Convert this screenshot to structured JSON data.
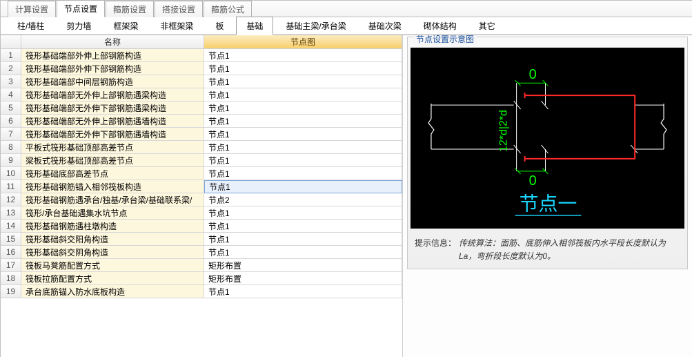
{
  "topTabs": {
    "items": [
      {
        "label": "计算设置"
      },
      {
        "label": "节点设置",
        "active": true
      },
      {
        "label": "箍筋设置"
      },
      {
        "label": "搭接设置"
      },
      {
        "label": "箍筋公式"
      }
    ]
  },
  "subTabs": {
    "items": [
      {
        "label": "柱/墙柱"
      },
      {
        "label": "剪力墙"
      },
      {
        "label": "框架梁"
      },
      {
        "label": "非框架梁"
      },
      {
        "label": "板"
      },
      {
        "label": "基础",
        "active": true
      },
      {
        "label": "基础主梁/承台梁"
      },
      {
        "label": "基础次梁"
      },
      {
        "label": "砌体结构"
      },
      {
        "label": "其它"
      }
    ]
  },
  "table": {
    "headers": {
      "name": "名称",
      "val": "节点图"
    },
    "rows": [
      {
        "n": "1",
        "name": "筏形基础端部外伸上部钢筋构造",
        "val": "节点1"
      },
      {
        "n": "2",
        "name": "筏形基础端部外伸下部钢筋构造",
        "val": "节点1"
      },
      {
        "n": "3",
        "name": "筏形基础端部中间层钢筋构造",
        "val": "节点1"
      },
      {
        "n": "4",
        "name": "筏形基础端部无外伸上部钢筋遇梁构造",
        "val": "节点1"
      },
      {
        "n": "5",
        "name": "筏形基础端部无外伸下部钢筋遇梁构造",
        "val": "节点1"
      },
      {
        "n": "6",
        "name": "筏形基础端部无外伸上部钢筋遇墙构造",
        "val": "节点1"
      },
      {
        "n": "7",
        "name": "筏形基础端部无外伸下部钢筋遇墙构造",
        "val": "节点1"
      },
      {
        "n": "8",
        "name": "平板式筏形基础顶部高差节点",
        "val": "节点1"
      },
      {
        "n": "9",
        "name": "梁板式筏形基础顶部高差节点",
        "val": "节点1"
      },
      {
        "n": "10",
        "name": "筏形基础底部高差节点",
        "val": "节点1"
      },
      {
        "n": "11",
        "name": "筏形基础钢筋锚入相邻筏板构造",
        "val": "节点1",
        "selected": true
      },
      {
        "n": "12",
        "name": "筏形基础钢筋遇承台/独基/承台梁/基础联系梁/",
        "val": "节点2"
      },
      {
        "n": "13",
        "name": "筏形/承台基础遇集水坑节点",
        "val": "节点1"
      },
      {
        "n": "14",
        "name": "筏形基础钢筋遇柱墩构造",
        "val": "节点1"
      },
      {
        "n": "15",
        "name": "筏形基础斜交阳角构造",
        "val": "节点1"
      },
      {
        "n": "16",
        "name": "筏形基础斜交阴角构造",
        "val": "节点1"
      },
      {
        "n": "17",
        "name": "筏板马凳筋配置方式",
        "val": "矩形布置"
      },
      {
        "n": "18",
        "name": "筏板拉筋配置方式",
        "val": "矩形布置"
      },
      {
        "n": "19",
        "name": "承台底筋锚入防水底板构造",
        "val": "节点1"
      }
    ]
  },
  "preview": {
    "title": "节点设置示意图",
    "annot_top": "0",
    "annot_bottom": "0",
    "annot_left": "12*d|2*d",
    "caption": "节点一",
    "hint_label": "提示信息：",
    "hint_text": "传统算法：面筋、底筋伸入相邻筏板内水平段长度默认为La，弯折段长度默认为0。"
  }
}
